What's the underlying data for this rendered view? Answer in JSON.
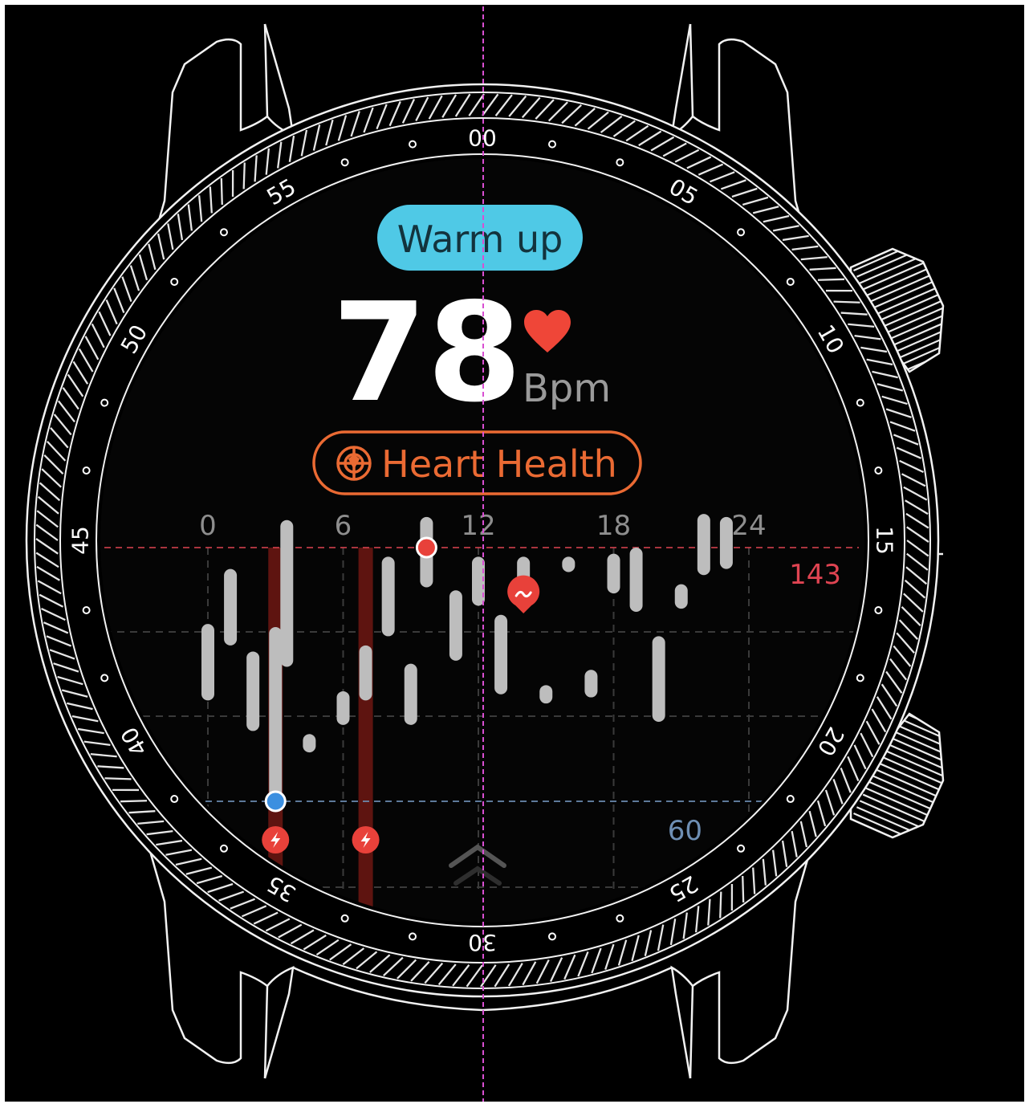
{
  "status_pill": {
    "label": "Warm up",
    "color": "#4fc9e6",
    "text_color": "#13333d"
  },
  "heart_rate": {
    "value": "78",
    "unit": "Bpm",
    "heart_color": "#ef4638"
  },
  "action_button": {
    "label": "Heart Health",
    "icon": "heart-radar-icon",
    "color": "#ea6a33"
  },
  "bezel": {
    "numbers": [
      "00",
      "05",
      "10",
      "15",
      "20",
      "25",
      "30",
      "35",
      "40",
      "45",
      "50",
      "55"
    ]
  },
  "chart_data": {
    "type": "range-bar",
    "x_ticks": [
      "0",
      "6",
      "12",
      "18",
      "24"
    ],
    "xlim": [
      0,
      24
    ],
    "ylim": [
      50,
      150
    ],
    "max_line": {
      "value": 143,
      "label": "143",
      "color": "#e04452"
    },
    "min_line": {
      "value": 60,
      "label": "60",
      "color": "#6e8fb4"
    },
    "bar_color": "#bdbdbd",
    "ranges": [
      {
        "x": 0.0,
        "low": 93,
        "high": 118
      },
      {
        "x": 1.0,
        "low": 111,
        "high": 136
      },
      {
        "x": 2.0,
        "low": 83,
        "high": 109
      },
      {
        "x": 3.0,
        "low": 60,
        "high": 117
      },
      {
        "x": 3.5,
        "low": 104,
        "high": 152
      },
      {
        "x": 4.5,
        "low": 76,
        "high": 82
      },
      {
        "x": 6.0,
        "low": 85,
        "high": 96
      },
      {
        "x": 7.0,
        "low": 93,
        "high": 111
      },
      {
        "x": 8.0,
        "low": 114,
        "high": 140
      },
      {
        "x": 9.0,
        "low": 85,
        "high": 105
      },
      {
        "x": 9.7,
        "low": 130,
        "high": 153
      },
      {
        "x": 11.0,
        "low": 106,
        "high": 129
      },
      {
        "x": 12.0,
        "low": 124,
        "high": 140
      },
      {
        "x": 13.0,
        "low": 95,
        "high": 121
      },
      {
        "x": 14.0,
        "low": 128,
        "high": 140
      },
      {
        "x": 15.0,
        "low": 92,
        "high": 98
      },
      {
        "x": 16.0,
        "low": 135,
        "high": 140
      },
      {
        "x": 17.0,
        "low": 94,
        "high": 103
      },
      {
        "x": 18.0,
        "low": 128,
        "high": 141
      },
      {
        "x": 19.0,
        "low": 122,
        "high": 143
      },
      {
        "x": 20.0,
        "low": 86,
        "high": 114
      },
      {
        "x": 21.0,
        "low": 123,
        "high": 131
      },
      {
        "x": 22.0,
        "low": 134,
        "high": 154
      },
      {
        "x": 23.0,
        "low": 136,
        "high": 153
      }
    ],
    "max_marker": {
      "x": 9.7,
      "value": 143
    },
    "min_marker": {
      "x": 3.0,
      "value": 60
    },
    "event_bands": [
      {
        "x": 3.0,
        "icon": "lightning-icon"
      },
      {
        "x": 7.0,
        "icon": "lightning-icon"
      }
    ],
    "event_pin": {
      "x": 14.0,
      "value": 127,
      "icon": "wave-icon"
    }
  },
  "scroll_hint": {
    "icon": "chevron-up-icon"
  }
}
